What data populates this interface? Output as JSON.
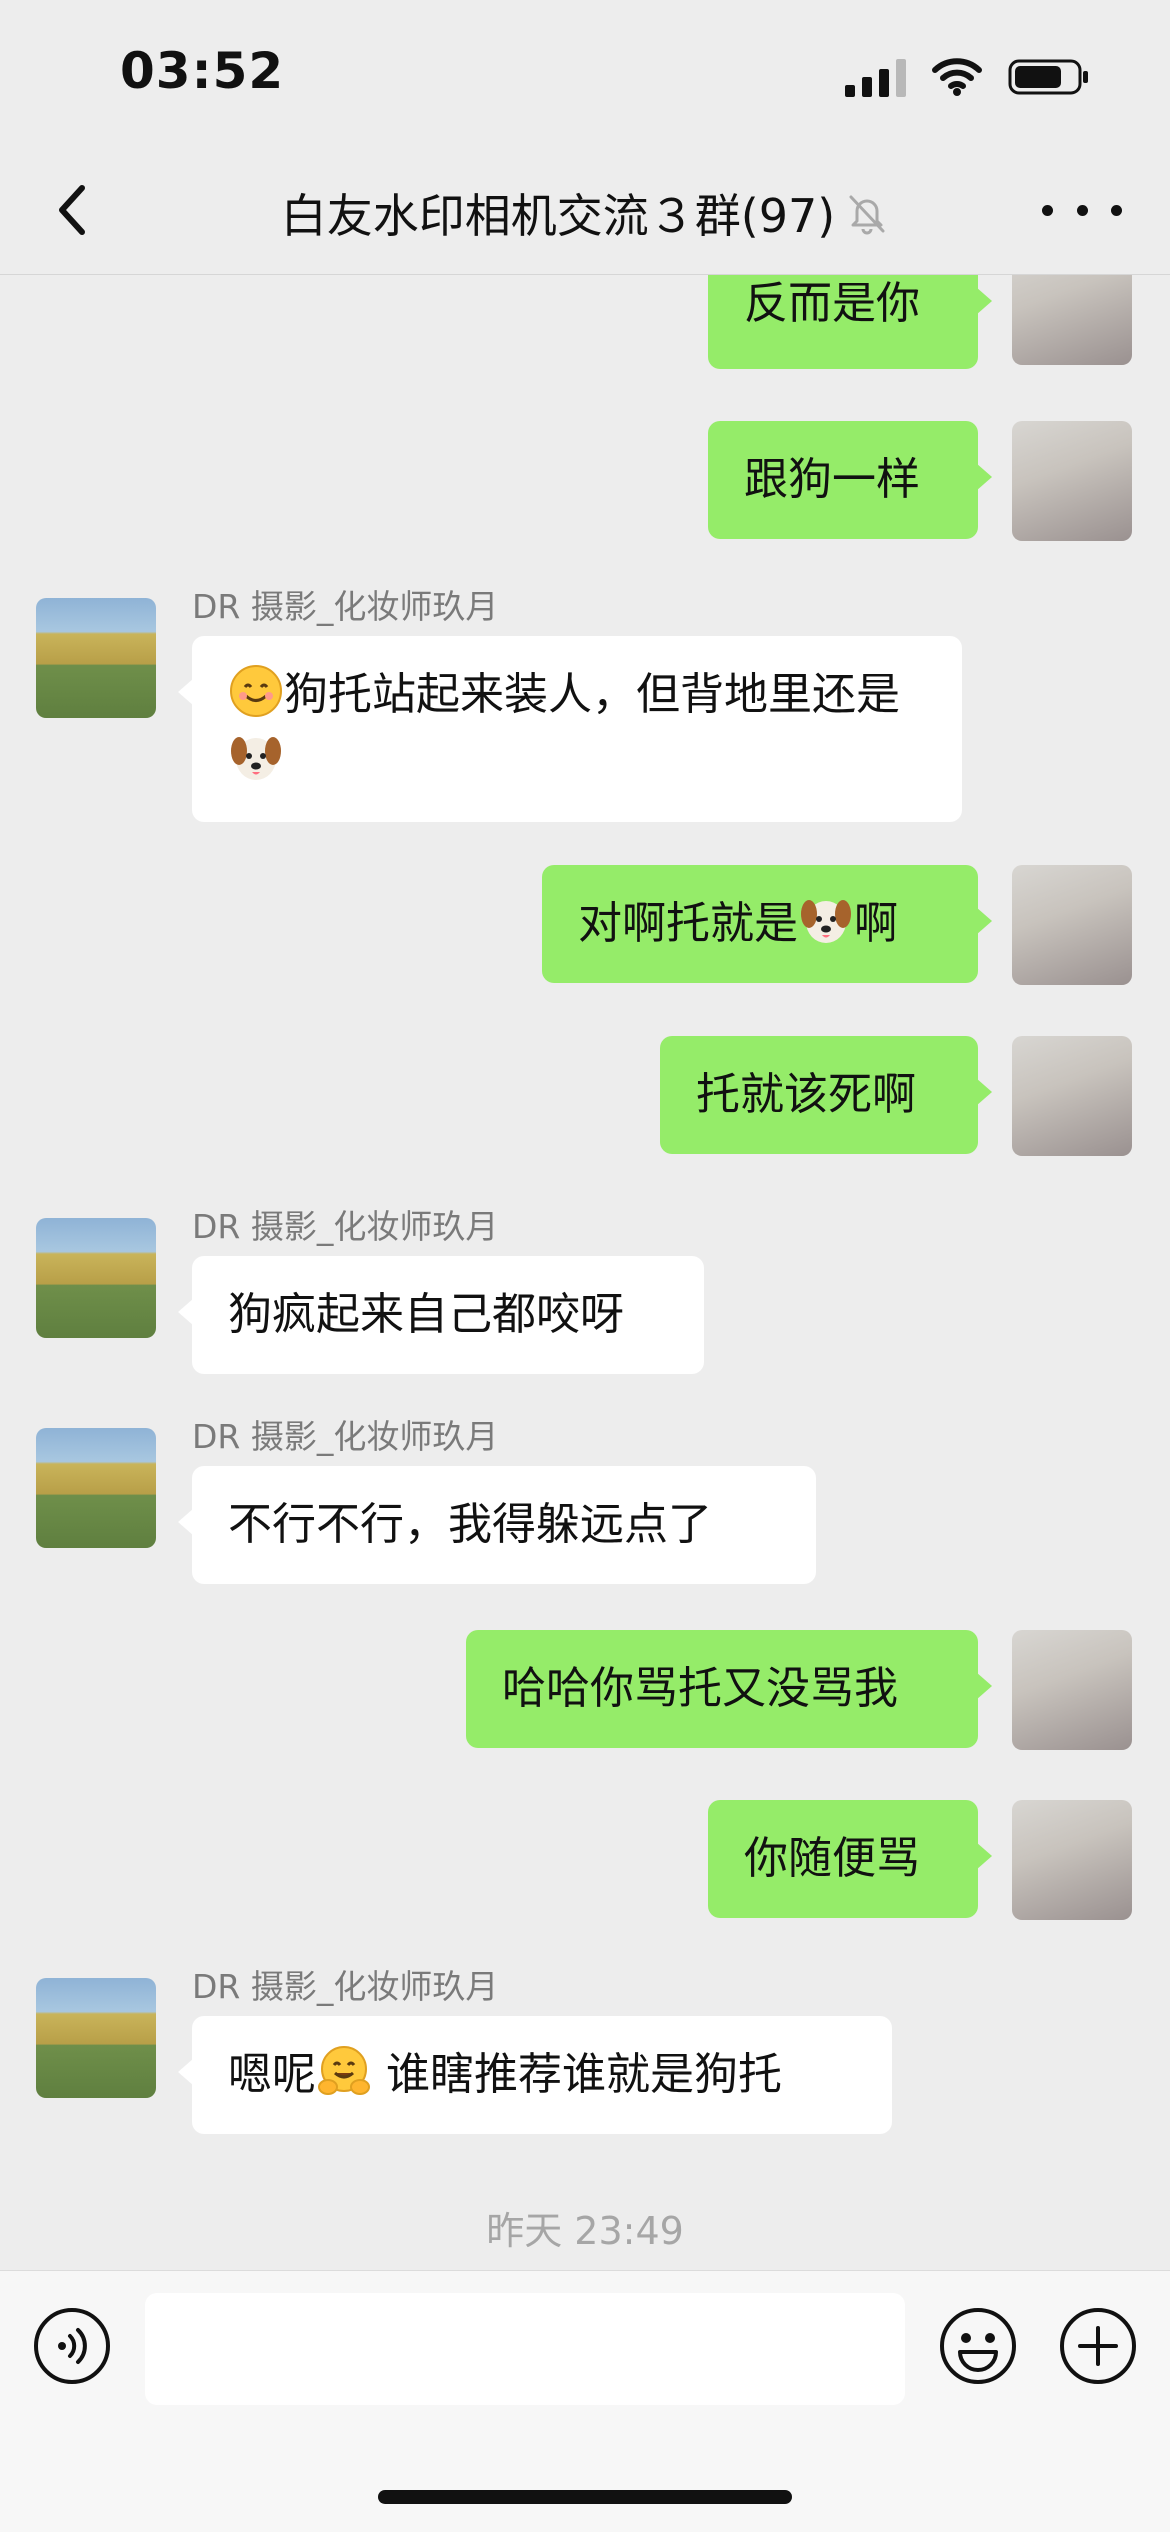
{
  "status_bar": {
    "time": "03:52"
  },
  "nav": {
    "title": "白友水印相机交流３群(97)"
  },
  "messages": [
    {
      "side": "self",
      "text": "反而是你"
    },
    {
      "side": "self",
      "text": "跟狗一样"
    },
    {
      "side": "other",
      "sender": "DR 摄影_化妆师玖月",
      "pre": "",
      "mid": "狗托站起来装人，但背地里还是",
      "post": ""
    },
    {
      "side": "self",
      "pre": "对啊托就是",
      "post": "啊"
    },
    {
      "side": "self",
      "text": "托就该死啊"
    },
    {
      "side": "other",
      "sender": "DR 摄影_化妆师玖月",
      "text": "狗疯起来自己都咬呀"
    },
    {
      "side": "other",
      "sender": "DR 摄影_化妆师玖月",
      "text": "不行不行，我得躲远点了"
    },
    {
      "side": "self",
      "text": "哈哈你骂托又没骂我"
    },
    {
      "side": "self",
      "text": "你随便骂"
    },
    {
      "side": "other",
      "sender": "DR 摄影_化妆师玖月",
      "pre": "嗯呢",
      "post": " 谁瞎推荐谁就是狗托"
    }
  ],
  "timestamp": "昨天 23:49",
  "input": {
    "value": ""
  },
  "icons": {
    "back": "chevron-left-icon",
    "mute": "bell-slash-icon",
    "more": "more-dots-icon",
    "voice": "voice-icon",
    "emoji": "smiley-icon",
    "plus": "plus-circle-icon"
  },
  "colors": {
    "self_bubble": "#95ec69",
    "other_bubble": "#ffffff",
    "background": "#ededed"
  }
}
